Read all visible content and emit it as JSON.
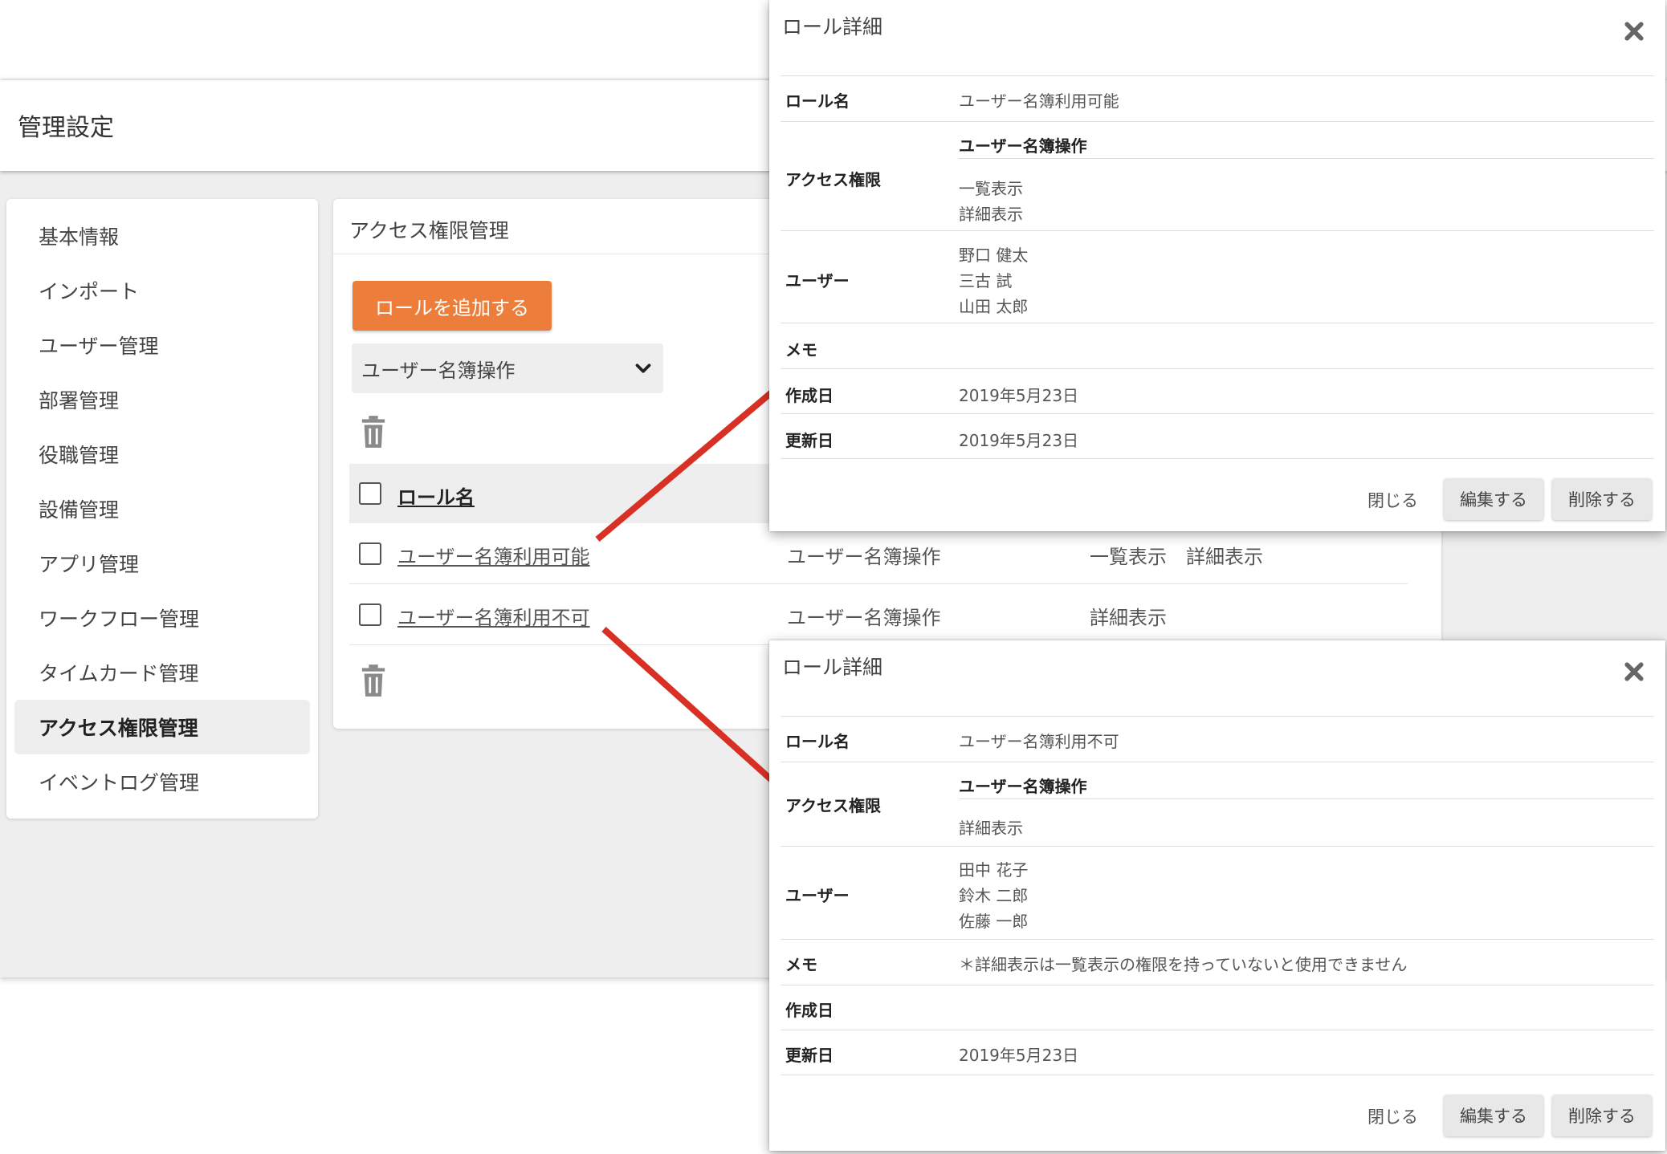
{
  "header": {
    "title": "管理設定"
  },
  "sidebar": {
    "items": [
      {
        "label": "基本情報"
      },
      {
        "label": "インポート"
      },
      {
        "label": "ユーザー管理"
      },
      {
        "label": "部署管理"
      },
      {
        "label": "役職管理"
      },
      {
        "label": "設備管理"
      },
      {
        "label": "アプリ管理"
      },
      {
        "label": "ワークフロー管理"
      },
      {
        "label": "タイムカード管理"
      },
      {
        "label": "アクセス権限管理",
        "active": true
      },
      {
        "label": "イベントログ管理"
      }
    ]
  },
  "main": {
    "title": "アクセス権限管理",
    "add_button": "ロールを追加する",
    "category_select": {
      "selected": "ユーザー名簿操作"
    },
    "table": {
      "header": {
        "role_name": "ロール名"
      },
      "rows": [
        {
          "role": "ユーザー名簿利用可能",
          "category": "ユーザー名簿操作",
          "permissions": "一覧表示　詳細表示"
        },
        {
          "role": "ユーザー名簿利用不可",
          "category": "ユーザー名簿操作",
          "permissions": "詳細表示"
        }
      ]
    }
  },
  "dialog1": {
    "title": "ロール詳細",
    "labels": {
      "role_name": "ロール名",
      "access": "アクセス権限",
      "users": "ユーザー",
      "memo": "メモ",
      "created": "作成日",
      "updated": "更新日"
    },
    "role_name": "ユーザー名簿利用可能",
    "access_category": "ユーザー名簿操作",
    "permissions": [
      "一覧表示",
      "詳細表示"
    ],
    "users": [
      "野口 健太",
      "三古 試",
      "山田 太郎"
    ],
    "memo": "",
    "created": "2019年5月23日",
    "updated": "2019年5月23日",
    "buttons": {
      "close": "閉じる",
      "edit": "編集する",
      "delete": "削除する"
    }
  },
  "dialog2": {
    "title": "ロール詳細",
    "labels": {
      "role_name": "ロール名",
      "access": "アクセス権限",
      "users": "ユーザー",
      "memo": "メモ",
      "created": "作成日",
      "updated": "更新日"
    },
    "role_name": "ユーザー名簿利用不可",
    "access_category": "ユーザー名簿操作",
    "permissions": [
      "詳細表示"
    ],
    "users": [
      "田中 花子",
      "鈴木 二郎",
      "佐藤 一郎"
    ],
    "memo": "＊詳細表示は一覧表示の権限を持っていないと使用できません",
    "created": "",
    "updated": "2019年5月23日",
    "buttons": {
      "close": "閉じる",
      "edit": "編集する",
      "delete": "削除する"
    }
  },
  "colors": {
    "accent": "#ec7d3a",
    "annotation": "#d93025"
  },
  "icons": {
    "delete": "trash-icon",
    "close": "close-icon",
    "dropdown": "chevron-down-icon"
  }
}
